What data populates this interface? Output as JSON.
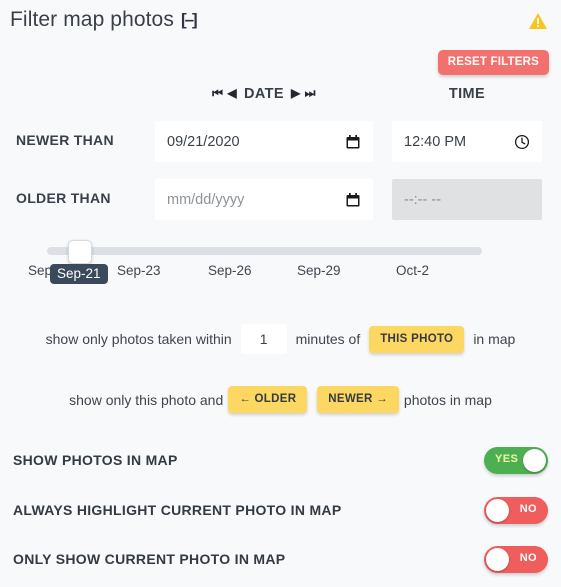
{
  "header": {
    "title": "Filter map photos",
    "collapse_icon": "collapse-icon",
    "collapse_glyph": "[–]",
    "warning_icon": "warning-triangle-icon",
    "reset_label": "RESET FILTERS",
    "reset_color": "#f2716e"
  },
  "columns": {
    "date_label": "DATE",
    "time_label": "TIME",
    "nav_first": "⏮",
    "nav_prev": "◀",
    "nav_next": "▶",
    "nav_last": "⏭"
  },
  "rows": {
    "newer": {
      "label": "NEWER THAN",
      "date_value": "09/21/2020",
      "date_placeholder": "mm/dd/yyyy",
      "time_value": "12:40 PM",
      "time_placeholder": "--:-- --",
      "time_disabled": false
    },
    "older": {
      "label": "OLDER THAN",
      "date_value": "",
      "date_placeholder": "mm/dd/yyyy",
      "time_value": "",
      "time_placeholder": "--:-- --",
      "time_disabled": true
    }
  },
  "slider": {
    "tooltip_value": "Sep-21",
    "ticks": [
      "Sep-20",
      "Sep-23",
      "Sep-26",
      "Sep-29",
      "Oct-2"
    ],
    "handle_position_pct": 5
  },
  "within_row": {
    "prefix": "show only photos taken within",
    "minutes_value": "1",
    "middle": "minutes of",
    "this_photo_label": "THIS PHOTO",
    "suffix": "in map"
  },
  "older_newer_row": {
    "prefix": "show only this photo and",
    "older_label": "← OLDER",
    "newer_label": "NEWER →",
    "suffix": "photos in map"
  },
  "toggles": [
    {
      "label": "SHOW PHOTOS IN MAP",
      "state": "YES",
      "on": true
    },
    {
      "label": "ALWAYS HIGHLIGHT CURRENT PHOTO IN MAP",
      "state": "NO",
      "on": false
    },
    {
      "label": "ONLY SHOW CURRENT PHOTO IN MAP",
      "state": "NO",
      "on": false
    }
  ],
  "colors": {
    "background": "#f8f9fb",
    "accent_yellow": "#fcd862",
    "accent_red": "#f2716e",
    "toggle_on": "#4caf50",
    "toggle_off": "#ef5e5c",
    "tooltip": "#3b4a5a"
  }
}
